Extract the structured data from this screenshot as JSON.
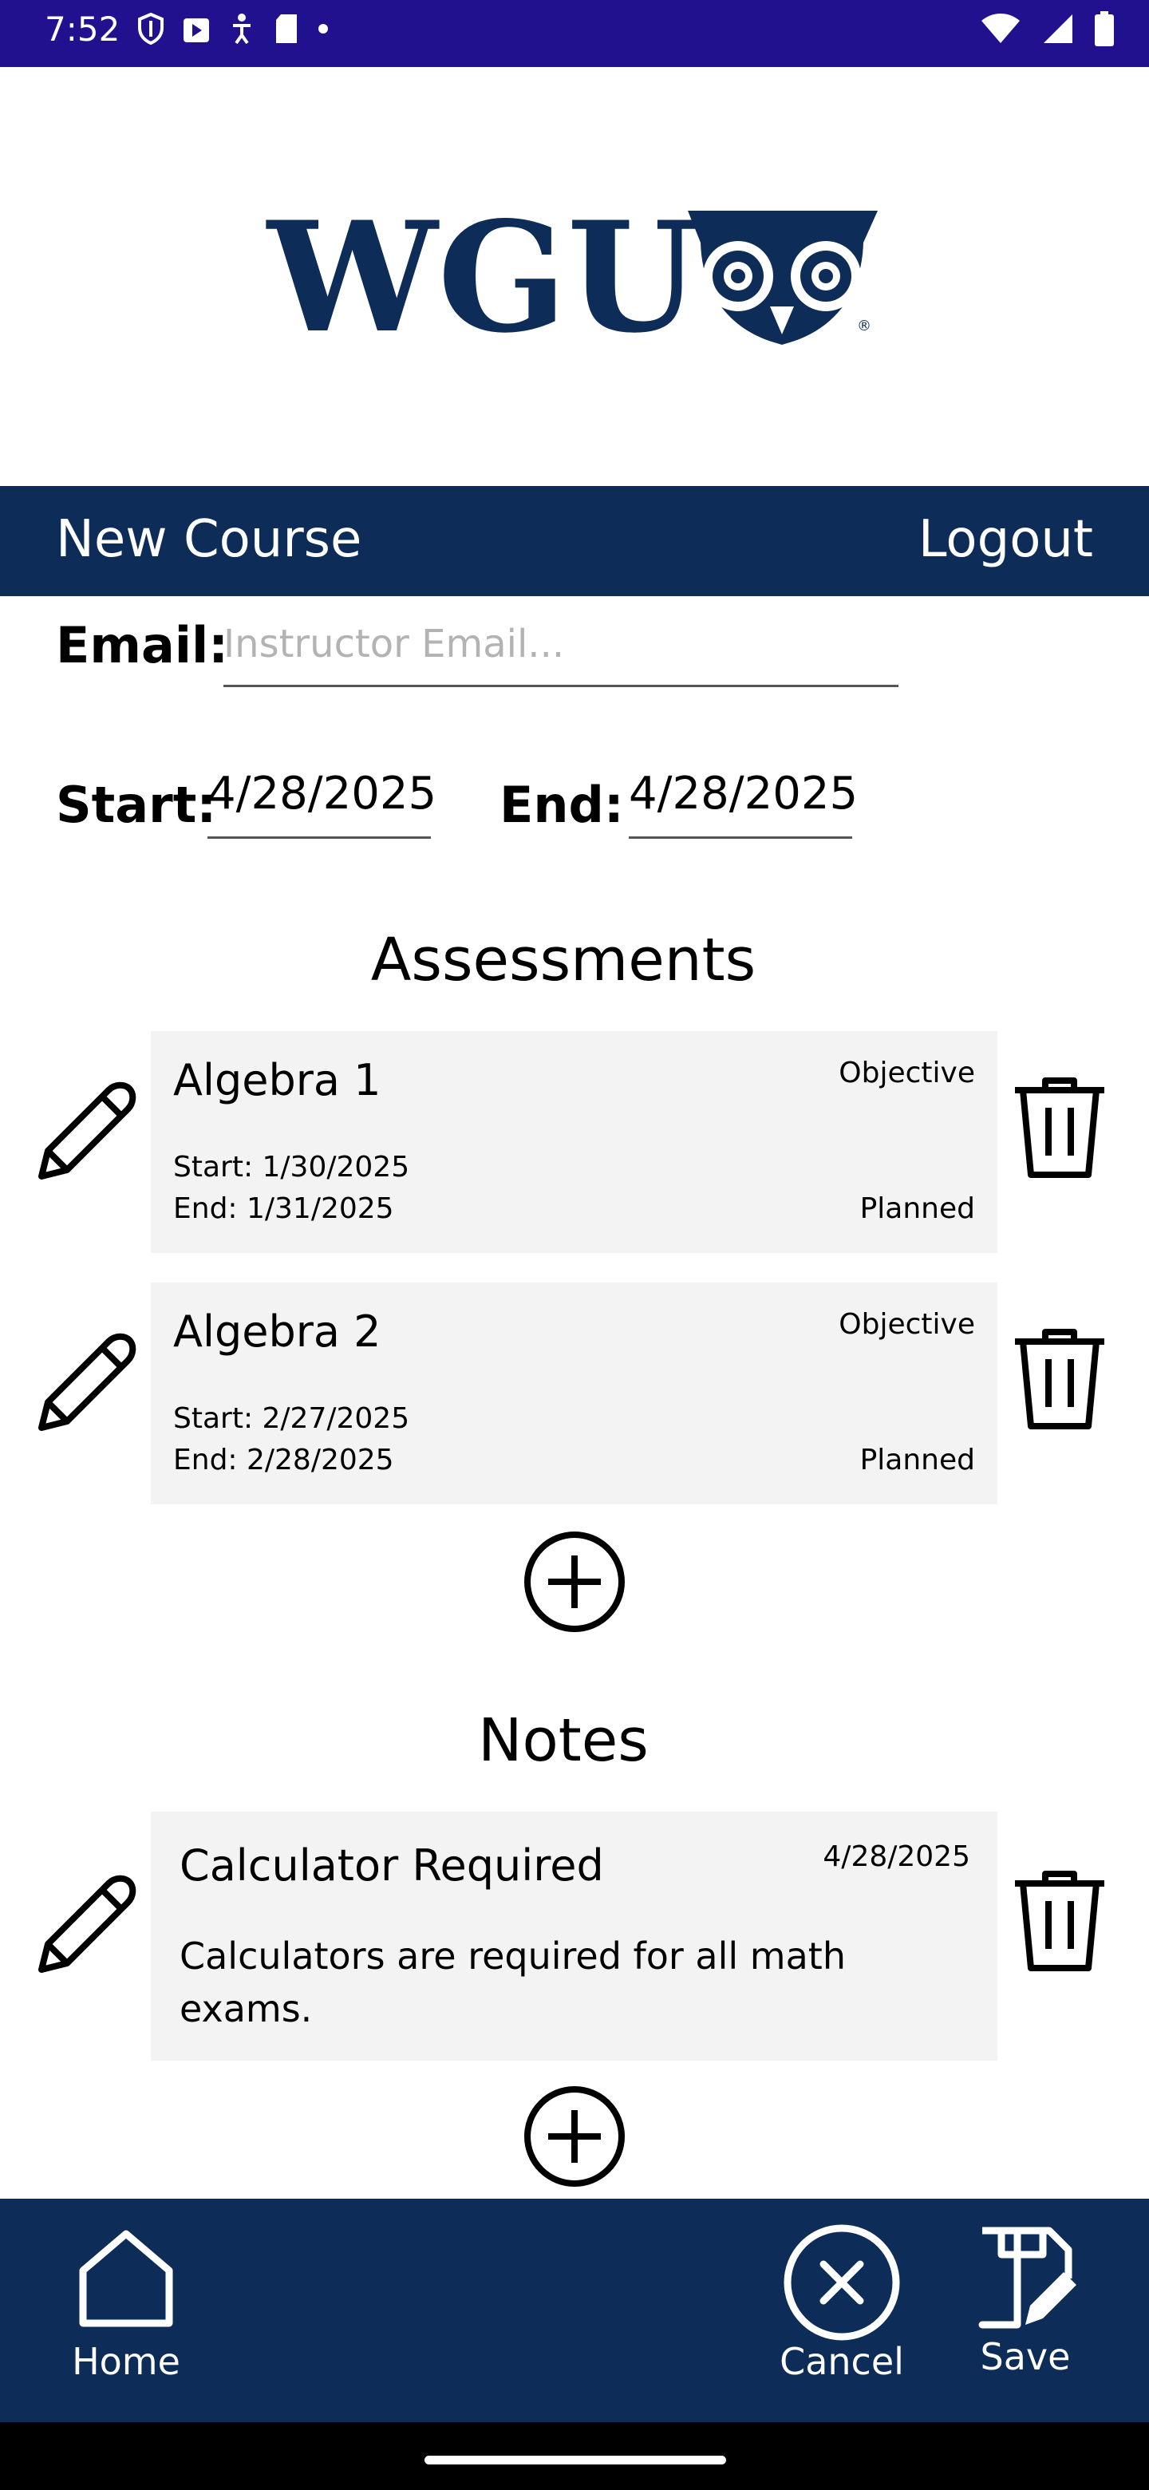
{
  "status_bar": {
    "time": "7:52",
    "icons": [
      "shield-icon",
      "play-store-icon",
      "accessibility-icon",
      "sd-card-icon",
      "dot-icon"
    ],
    "right_icons": [
      "wifi-icon",
      "signal-icon",
      "battery-icon"
    ]
  },
  "logo": {
    "text": "WGU"
  },
  "nav": {
    "title": "New Course",
    "logout": "Logout"
  },
  "form": {
    "email_label": "Email:",
    "email_placeholder": "Instructor Email...",
    "start_label": "Start:",
    "start_value": "4/28/2025",
    "end_label": "End:",
    "end_value": "4/28/2025"
  },
  "assessments": {
    "title": "Assessments",
    "items": [
      {
        "name": "Algebra 1",
        "type": "Objective",
        "start": "Start: 1/30/2025",
        "end": "End: 1/31/2025",
        "status": "Planned"
      },
      {
        "name": "Algebra 2",
        "type": "Objective",
        "start": "Start: 2/27/2025",
        "end": "End: 2/28/2025",
        "status": "Planned"
      }
    ]
  },
  "notes": {
    "title": "Notes",
    "items": [
      {
        "title": "Calculator Required",
        "date": "4/28/2025",
        "body": "Calculators are required for all math exams."
      }
    ]
  },
  "bottom_nav": {
    "home": "Home",
    "cancel": "Cancel",
    "save": "Save"
  },
  "colors": {
    "status_bar": "#22118f",
    "nav": "#0d2c57",
    "card": "#f3f3f3",
    "logo": "#0d2c57"
  }
}
